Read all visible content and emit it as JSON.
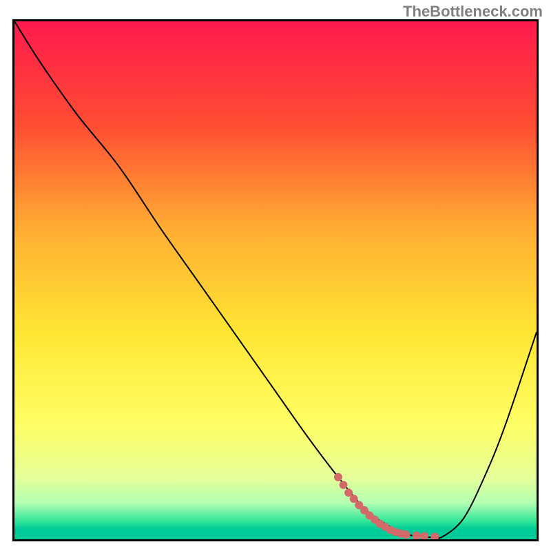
{
  "watermark": "TheBottleneck.com",
  "chart_data": {
    "type": "line",
    "title": "",
    "xlabel": "",
    "ylabel": "",
    "xlim": [
      0,
      100
    ],
    "ylim": [
      0,
      100
    ],
    "gradient_stops": [
      {
        "offset": 0,
        "color": "#ff1a4d"
      },
      {
        "offset": 20,
        "color": "#ff4d33"
      },
      {
        "offset": 40,
        "color": "#ffad33"
      },
      {
        "offset": 60,
        "color": "#ffe633"
      },
      {
        "offset": 78,
        "color": "#ffff66"
      },
      {
        "offset": 88,
        "color": "#e6ff99"
      },
      {
        "offset": 93,
        "color": "#b3ffb3"
      },
      {
        "offset": 96.5,
        "color": "#33e699"
      },
      {
        "offset": 98,
        "color": "#00cc99"
      },
      {
        "offset": 100,
        "color": "#00cc99"
      }
    ],
    "series": [
      {
        "name": "bottleneck-curve",
        "color": "#000000",
        "stroke_width": 2,
        "x": [
          0,
          5,
          12,
          20,
          28,
          35,
          42,
          49,
          56,
          62,
          67,
          71,
          75,
          78,
          80,
          82,
          86,
          90,
          94,
          100
        ],
        "values": [
          100,
          92,
          82,
          72,
          60,
          50,
          40,
          30,
          20,
          12,
          6,
          3,
          1,
          0.5,
          0.4,
          0.5,
          4,
          12,
          22,
          40
        ]
      }
    ],
    "dotted_segment": {
      "name": "highlight-dots",
      "color": "#d26a6a",
      "radius": 6,
      "points": [
        {
          "x": 62.0,
          "y": 12.0
        },
        {
          "x": 63.0,
          "y": 10.5
        },
        {
          "x": 64.0,
          "y": 9.0
        },
        {
          "x": 65.0,
          "y": 7.8
        },
        {
          "x": 66.0,
          "y": 6.6
        },
        {
          "x": 67.0,
          "y": 5.6
        },
        {
          "x": 68.0,
          "y": 4.6
        },
        {
          "x": 69.0,
          "y": 3.8
        },
        {
          "x": 70.0,
          "y": 3.0
        },
        {
          "x": 71.0,
          "y": 2.4
        },
        {
          "x": 72.0,
          "y": 1.8
        },
        {
          "x": 73.0,
          "y": 1.4
        },
        {
          "x": 74.0,
          "y": 1.1
        },
        {
          "x": 75.0,
          "y": 0.9
        },
        {
          "x": 77.0,
          "y": 0.7
        },
        {
          "x": 78.5,
          "y": 0.6
        },
        {
          "x": 80.5,
          "y": 0.5
        }
      ]
    }
  }
}
